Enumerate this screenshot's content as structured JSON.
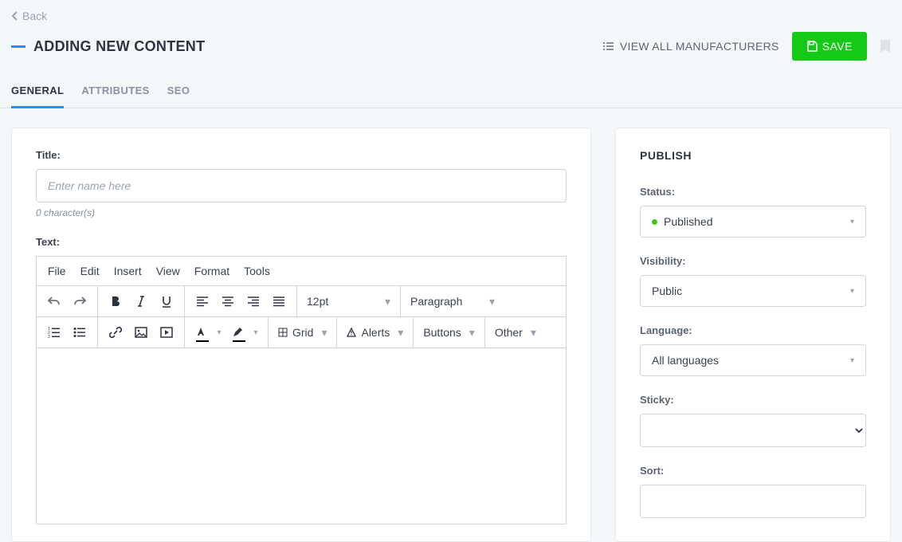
{
  "back": {
    "label": "Back"
  },
  "header": {
    "title": "ADDING NEW CONTENT",
    "view_all": "VIEW ALL MANUFACTURERS",
    "save": "SAVE"
  },
  "tabs": {
    "general": "GENERAL",
    "attributes": "ATTRIBUTES",
    "seo": "SEO"
  },
  "main": {
    "title_label": "Title:",
    "title_placeholder": "Enter name here",
    "char_count_num": "0",
    "char_count_text": " character(s)",
    "text_label": "Text:",
    "editor_menu": {
      "file": "File",
      "edit": "Edit",
      "insert": "Insert",
      "view": "View",
      "format": "Format",
      "tools": "Tools"
    },
    "toolbar": {
      "fontsize": "12pt",
      "format": "Paragraph",
      "grid": "Grid",
      "alerts": "Alerts",
      "buttons": "Buttons",
      "other": "Other"
    }
  },
  "publish": {
    "heading": "PUBLISH",
    "status_label": "Status:",
    "status_value": "Published",
    "visibility_label": "Visibility:",
    "visibility_value": "Public",
    "language_label": "Language:",
    "language_value": "All languages",
    "sticky_label": "Sticky:",
    "sort_label": "Sort:"
  }
}
